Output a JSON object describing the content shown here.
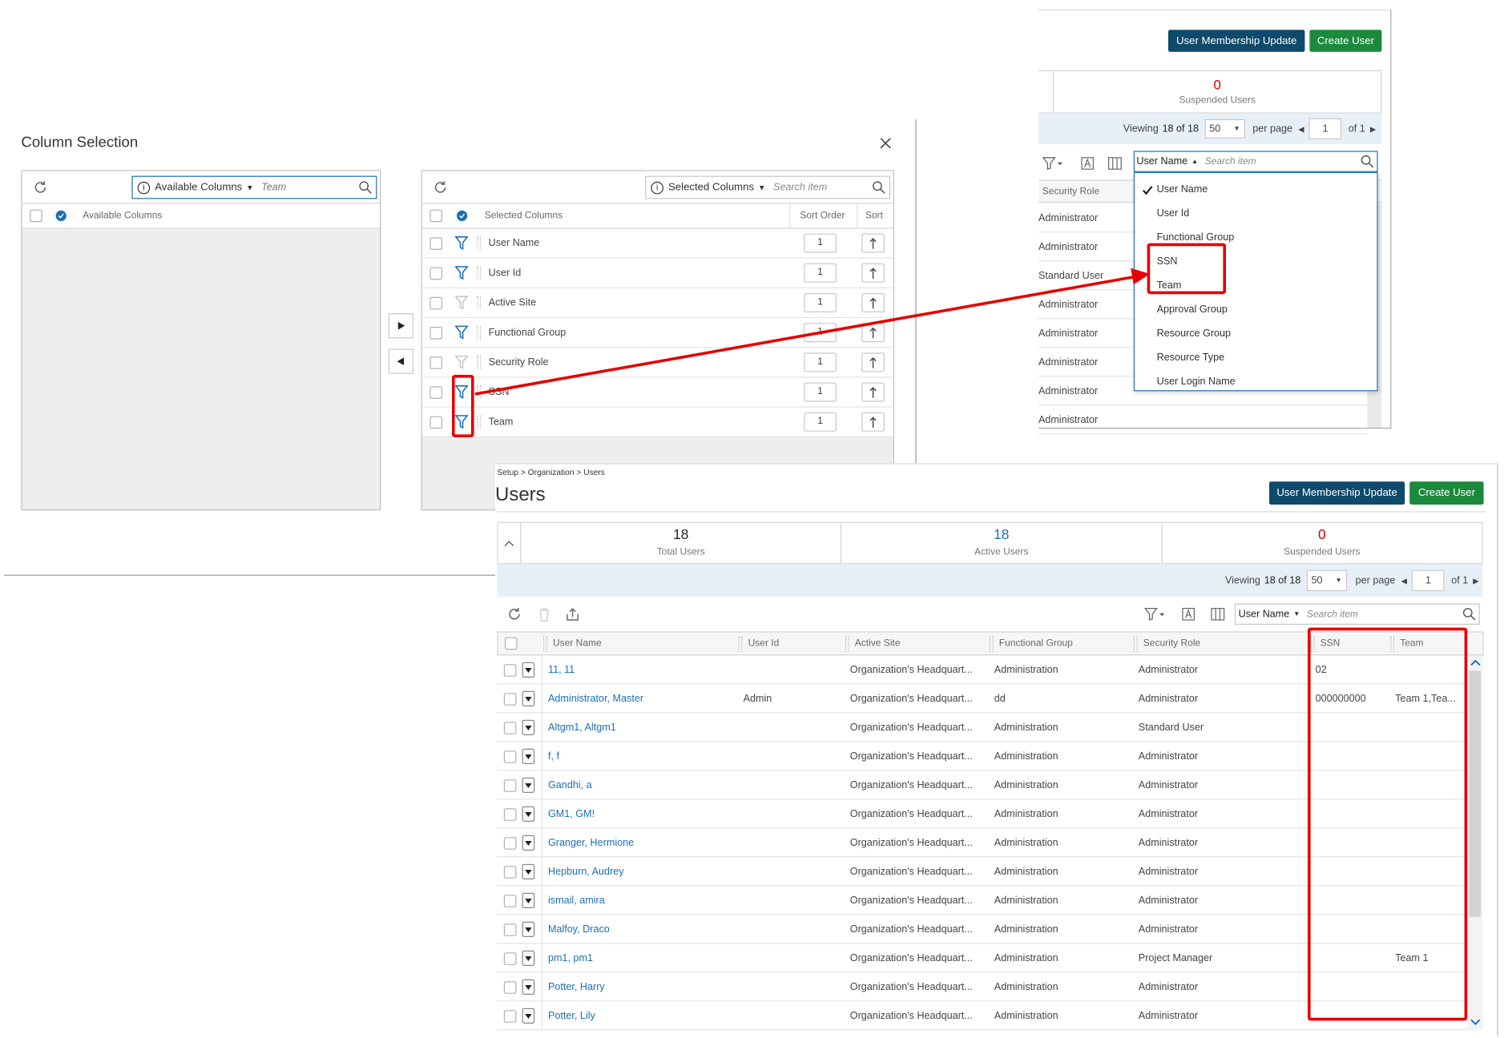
{
  "column_selection": {
    "title": "Column Selection",
    "available": {
      "dropdown_label": "Available Columns",
      "search_value": "Team",
      "header": "Available Columns"
    },
    "selected": {
      "dropdown_label": "Selected Columns",
      "search_placeholder": "Search item",
      "headers": {
        "col": "Selected Columns",
        "sort_order": "Sort Order",
        "sort": "Sort"
      },
      "rows": [
        {
          "label": "User Name",
          "sort_order": "1",
          "filter": "active"
        },
        {
          "label": "User Id",
          "sort_order": "1",
          "filter": "active"
        },
        {
          "label": "Active Site",
          "sort_order": "1",
          "filter": "inactive"
        },
        {
          "label": "Functional Group",
          "sort_order": "1",
          "filter": "active"
        },
        {
          "label": "Security Role",
          "sort_order": "1",
          "filter": "inactive"
        },
        {
          "label": "SSN",
          "sort_order": "1",
          "filter": "active"
        },
        {
          "label": "Team",
          "sort_order": "1",
          "filter": "active"
        }
      ]
    }
  },
  "top_snippet": {
    "btn_membership": "User Membership Update",
    "btn_create": "Create User",
    "suspended_count": "0",
    "suspended_label": "Suspended Users",
    "viewing_prefix": "Viewing",
    "viewing_range": "18 of 18",
    "per_page_value": "50",
    "per_page_label": "per page",
    "page_value": "1",
    "of_label": "of 1",
    "search_field": "User Name",
    "search_placeholder": "Search item",
    "col_header": "Security Role",
    "roles": [
      "Administrator",
      "Administrator",
      "Standard User",
      "Administrator",
      "Administrator",
      "Administrator",
      "Administrator",
      "Administrator"
    ],
    "dropdown_items": [
      "User Name",
      "User Id",
      "Functional Group",
      "SSN",
      "Team",
      "Approval Group",
      "Resource Group",
      "Resource Type",
      "User Login Name"
    ]
  },
  "users_page": {
    "breadcrumb": "Setup > Organization > Users",
    "title": "Users",
    "btn_membership": "User Membership Update",
    "btn_create": "Create User",
    "stats": [
      {
        "value": "18",
        "label": "Total Users",
        "color": "#222222"
      },
      {
        "value": "18",
        "label": "Active Users",
        "color": "#1b6fb5"
      },
      {
        "value": "0",
        "label": "Suspended Users",
        "color": "#d00000"
      }
    ],
    "viewing_prefix": "Viewing",
    "viewing_range": "18 of 18",
    "per_page_value": "50",
    "per_page_label": "per page",
    "page_value": "1",
    "of_label": "of 1",
    "search_field": "User Name",
    "search_placeholder": "Search item",
    "columns": [
      "User Name",
      "User Id",
      "Active Site",
      "Functional Group",
      "Security Role",
      "SSN",
      "Team"
    ],
    "rows": [
      [
        "11, 11",
        "",
        "Organization's Headquart...",
        "Administration",
        "Administrator",
        "02",
        ""
      ],
      [
        "Administrator, Master",
        "Admin",
        "Organization's Headquart...",
        "dd",
        "Administrator",
        "000000000",
        "Team 1,Tea..."
      ],
      [
        "Altgm1, Altgm1",
        "",
        "Organization's Headquart...",
        "Administration",
        "Standard User",
        "",
        ""
      ],
      [
        "f, f",
        "",
        "Organization's Headquart...",
        "Administration",
        "Administrator",
        "",
        ""
      ],
      [
        "Gandhi, a",
        "",
        "Organization's Headquart...",
        "Administration",
        "Administrator",
        "",
        ""
      ],
      [
        "GM1, GM!",
        "",
        "Organization's Headquart...",
        "Administration",
        "Administrator",
        "",
        ""
      ],
      [
        "Granger, Hermione",
        "",
        "Organization's Headquart...",
        "Administration",
        "Administrator",
        "",
        ""
      ],
      [
        "Hepburn, Audrey",
        "",
        "Organization's Headquart...",
        "Administration",
        "Administrator",
        "",
        ""
      ],
      [
        "ismail, amira",
        "",
        "Organization's Headquart...",
        "Administration",
        "Administrator",
        "",
        ""
      ],
      [
        "Malfoy, Draco",
        "",
        "Organization's Headquart...",
        "Administration",
        "Administrator",
        "",
        ""
      ],
      [
        "pm1, pm1",
        "",
        "Organization's Headquart...",
        "Administration",
        "Project Manager",
        "",
        "Team 1"
      ],
      [
        "Potter, Harry",
        "",
        "Organization's Headquart...",
        "Administration",
        "Administrator",
        "",
        ""
      ],
      [
        "Potter, Lily",
        "",
        "Organization's Headquart...",
        "Administration",
        "Administrator",
        "",
        ""
      ]
    ]
  },
  "colors": {
    "accent": "#1b6fb5",
    "dark_button": "#0d4a6b",
    "green_button": "#1c8a3c",
    "highlight": "#e60000"
  }
}
